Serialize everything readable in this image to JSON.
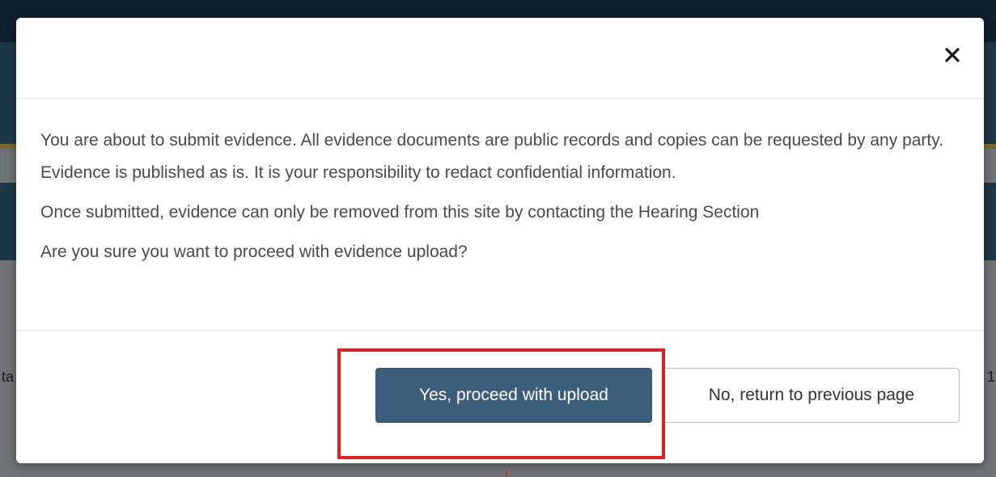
{
  "background": {
    "left_fragment": "ta",
    "right_fragment": "1"
  },
  "modal": {
    "close_icon": "close-icon",
    "body": {
      "paragraph_1": "You are about to submit evidence. All evidence documents are public records and copies can be requested by any party. Evidence is published as is. It is your responsibility to redact confidential information.",
      "paragraph_2": "Once submitted, evidence can only be removed from this site by contacting the Hearing Section",
      "paragraph_3": "Are you sure you want to proceed with evidence upload?"
    },
    "footer": {
      "confirm_label": "Yes, proceed with upload",
      "cancel_label": "No, return to previous page"
    }
  },
  "colors": {
    "primary_button": "#3d5e7a",
    "highlight": "#e02020",
    "body_text": "#4a4a4a"
  }
}
